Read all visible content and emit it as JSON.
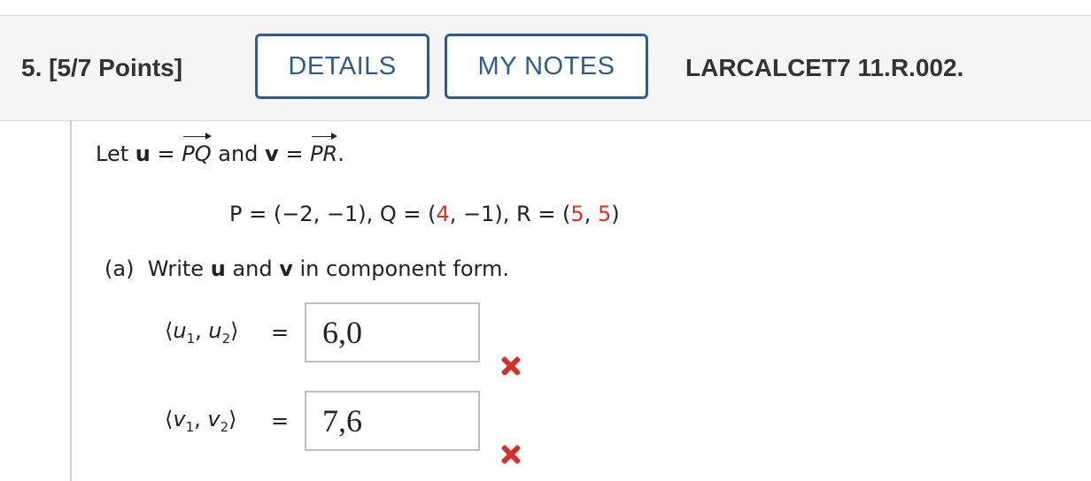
{
  "header": {
    "question_label": "5. [5/7 Points]",
    "details_label": "DETAILS",
    "notes_label": "MY NOTES",
    "problem_code": "LARCALCET7 11.R.002."
  },
  "problem": {
    "let_text": "Let",
    "u_var": "u",
    "eq_text": " = ",
    "pq_label": "PQ",
    "and_text": " and ",
    "v_var": "v",
    "pr_label": "PR",
    "period": ".",
    "points_line": {
      "p_part": "P = (−2, −1), Q = (",
      "q_x": "4",
      "q_rest": ", −1), R = (",
      "r_x": "5",
      "r_sep": ", ",
      "r_y": "5",
      "r_close": ")"
    },
    "part_a_label": "(a)",
    "part_a_text_1": "Write ",
    "part_a_text_2": " and ",
    "part_a_text_3": " in component form."
  },
  "answers": [
    {
      "label_var": "u",
      "equals": "=",
      "value": "6,0",
      "status": "incorrect"
    },
    {
      "label_var": "v",
      "equals": "=",
      "value": "7,6",
      "status": "incorrect"
    }
  ],
  "colors": {
    "accent": "#2c5d8e",
    "error": "#d32f2f",
    "given_value": "#d93025"
  }
}
